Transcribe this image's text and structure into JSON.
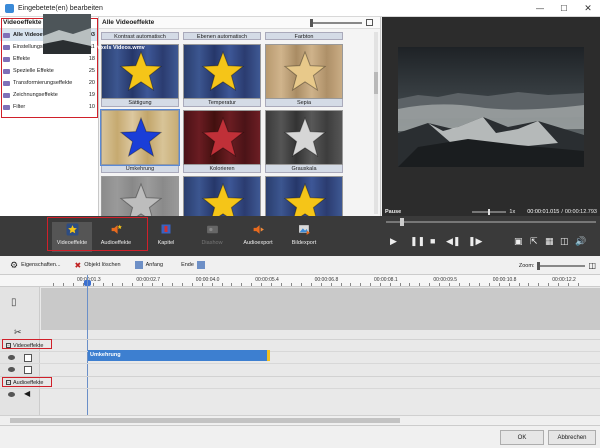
{
  "window": {
    "title": "Eingebetete(en) bearbeiten"
  },
  "categories": {
    "header": "Videoeffekte",
    "items": [
      {
        "label": "Alle Videoeffekte",
        "count": "103",
        "selected": true
      },
      {
        "label": "Einstellungseffekte",
        "count": "11"
      },
      {
        "label": "Effekte",
        "count": "18"
      },
      {
        "label": "Spezielle Effekte",
        "count": "25"
      },
      {
        "label": "Transformierungseffekte",
        "count": "20"
      },
      {
        "label": "Zeichnungseffekte",
        "count": "19"
      },
      {
        "label": "Filter",
        "count": "10"
      }
    ]
  },
  "effects": {
    "header": "Alle Videoeffekte",
    "top_labels": [
      "Kontrast automatisch",
      "Ebenen automatisch",
      "Farbton"
    ],
    "tiles": [
      {
        "label": "Sättigung",
        "star": "#f5c518",
        "bg": "blue"
      },
      {
        "label": "Temperatur",
        "star": "#f5c518",
        "bg": "blue"
      },
      {
        "label": "Sepia",
        "star": "#e8c98a",
        "bg": "sepia"
      },
      {
        "label": "Umkehrung",
        "star": "#1a3ed8",
        "bg": "invert",
        "selected": true
      },
      {
        "label": "Kolorieren",
        "star": "#c03038",
        "bg": "red"
      },
      {
        "label": "Grauskala",
        "star": "#d6d6d6",
        "bg": "gray"
      },
      {
        "label": "Prägen",
        "star": "#bdbdbd",
        "bg": "emboss"
      },
      {
        "label": "Scharfstellen",
        "star": "#f5c518",
        "bg": "blue"
      },
      {
        "label": "Weichzeichnen",
        "star": "#f5c518",
        "bg": "blue"
      }
    ]
  },
  "preview": {
    "state": "Pause",
    "speed": "1x",
    "current_time": "00:00:01.015",
    "separator": "/",
    "total_time": "00:00:12.793"
  },
  "toolbar": {
    "buttons": [
      {
        "label": "Videoeffekte",
        "icon": "star-icon",
        "active": true
      },
      {
        "label": "Audioeffekte",
        "icon": "speaker-star-icon"
      },
      {
        "label": "Kapitel",
        "icon": "chapter-icon"
      },
      {
        "label": "Diashow",
        "icon": "slideshow-icon",
        "disabled": true
      },
      {
        "label": "Audioexport",
        "icon": "audio-export-icon"
      },
      {
        "label": "Bildexport",
        "icon": "image-export-icon"
      }
    ]
  },
  "timeline_tools": {
    "properties": "Eigenschaften...",
    "delete": "Objekt löschen",
    "start": "Anfang",
    "end": "Ende",
    "zoom": "Zoom:"
  },
  "timeline": {
    "ticks": [
      "00:00:01.3",
      "00:00:02.7",
      "00:00:04.0",
      "00:00:05.4",
      "00:00:06.8",
      "00:00:08.1",
      "00:00:09.5",
      "00:00:10.8",
      "00:00:12.2"
    ],
    "clip_label": "Pexels Videos.wmv",
    "video_section": "Videoeffekte",
    "audio_section": "Audioeffekte",
    "effect_clip": "Umkehrung"
  },
  "footer": {
    "ok": "OK",
    "cancel": "Abbrechen"
  },
  "colors": {
    "accent": "#3d7fd0",
    "highlight_box": "#d0202a",
    "toolbar_bg": "#3a3a3a"
  }
}
